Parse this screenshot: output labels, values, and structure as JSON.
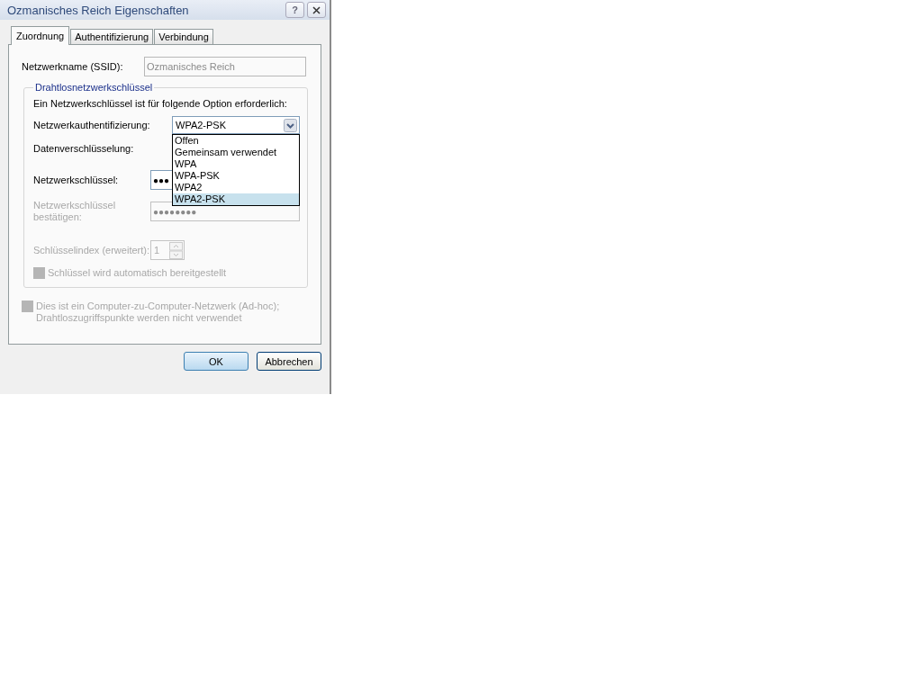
{
  "window": {
    "title": "Ozmanisches Reich Eigenschaften",
    "help_button": "?"
  },
  "tabs": [
    {
      "label": "Zuordnung",
      "selected": true
    },
    {
      "label": "Authentifizierung",
      "selected": false
    },
    {
      "label": "Verbindung",
      "selected": false
    }
  ],
  "ssid": {
    "label": "Netzwerkname (SSID):",
    "value": "Ozmanisches Reich",
    "disabled": true
  },
  "group": {
    "legend": "Drahtlosnetzwerkschlüssel",
    "intro": "Ein Netzwerkschlüssel ist für folgende Option erforderlich:",
    "auth": {
      "label": "Netzwerkauthentifizierung:",
      "value": "WPA2-PSK",
      "expanded": true,
      "options": [
        {
          "label": "Offen",
          "selected": false
        },
        {
          "label": "Gemeinsam verwendet",
          "selected": false
        },
        {
          "label": "WPA",
          "selected": false
        },
        {
          "label": "WPA-PSK",
          "selected": false
        },
        {
          "label": "WPA2",
          "selected": false
        },
        {
          "label": "WPA2-PSK",
          "selected": true
        }
      ]
    },
    "encryption": {
      "label": "Datenverschlüsselung:"
    },
    "key": {
      "label": "Netzwerkschlüssel:",
      "value": "●●●",
      "disabled": false
    },
    "confirm": {
      "label": "Netzwerkschlüssel bestätigen:",
      "value": "●●●●●●●●",
      "disabled": true
    },
    "key_index": {
      "label": "Schlüsselindex (erweitert):",
      "value": "1",
      "disabled": true
    },
    "auto_key": {
      "label": "Schlüssel wird automatisch bereitgestellt",
      "checked": false,
      "disabled": true
    }
  },
  "adhoc": {
    "label": "Dies ist ein Computer-zu-Computer-Netzwerk (Ad-hoc); Drahtloszugriffspunkte werden nicht verwendet",
    "checked": false,
    "disabled": true
  },
  "buttons": [
    {
      "label": "OK",
      "kind": "default"
    },
    {
      "label": "Abbrechen",
      "kind": "normal"
    }
  ]
}
